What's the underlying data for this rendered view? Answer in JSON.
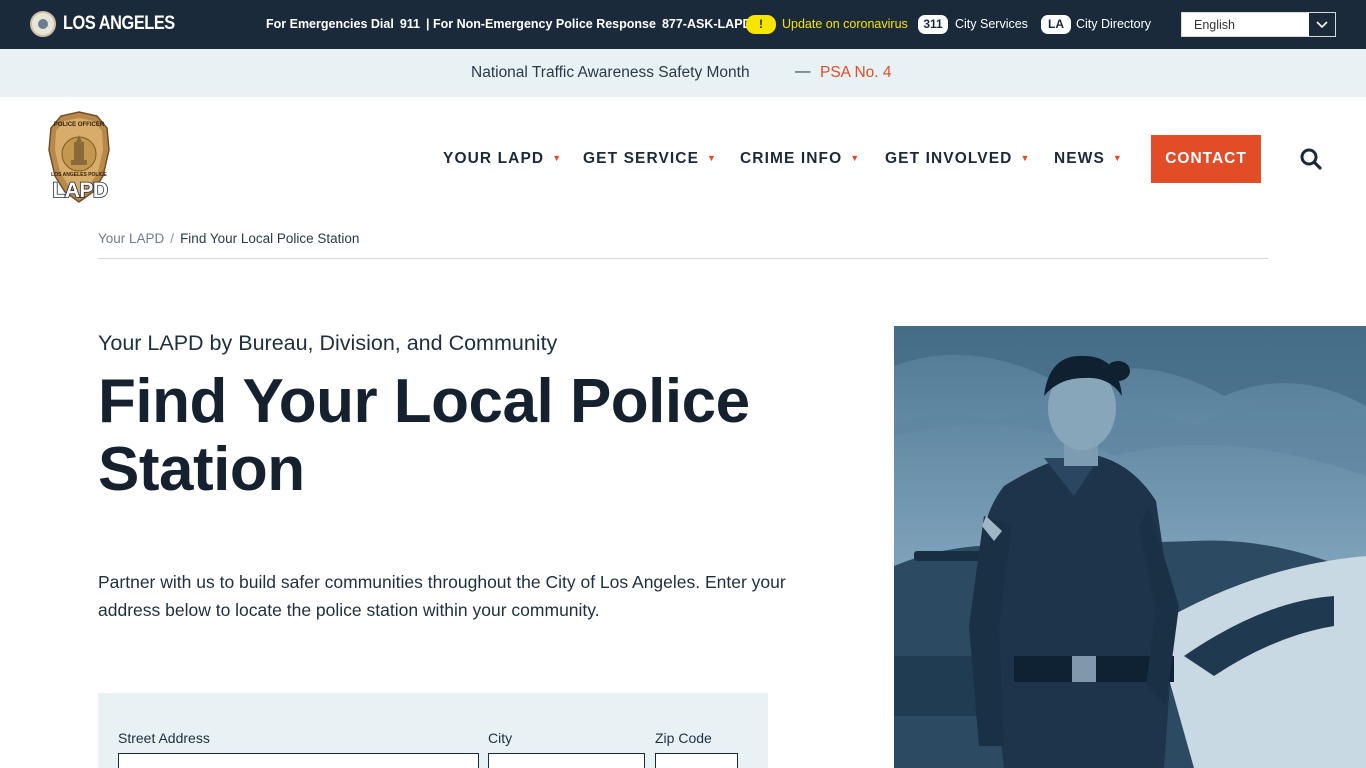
{
  "topbar": {
    "city_name": "LOS ANGELES",
    "emergency_label": "For Emergencies Dial",
    "emergency_number": "911",
    "nonemergency_label": "| For Non-Emergency Police Response",
    "nonemergency_number": "877-ASK-LAPD",
    "covid_badge": "!",
    "covid_link": "Update on coronavirus",
    "services_badge": "311",
    "services_link": "City Services",
    "directory_badge": "LA",
    "directory_link": "City Directory",
    "language_selected": "English"
  },
  "alert": {
    "text": "National Traffic Awareness Safety Month",
    "dash": "—",
    "link": "PSA No. 4"
  },
  "header": {
    "logo_text_top": "POLICE OFFICER",
    "logo_text_bottom": "LOS ANGELES POLICE",
    "logo_wordmark": "LAPD",
    "nav": [
      {
        "label": "YOUR LAPD"
      },
      {
        "label": "GET SERVICE"
      },
      {
        "label": "CRIME INFO"
      },
      {
        "label": "GET INVOLVED"
      },
      {
        "label": "NEWS"
      }
    ],
    "contact_label": "CONTACT"
  },
  "breadcrumb": {
    "parent": "Your LAPD",
    "separator": "/",
    "current": "Find Your Local Police Station"
  },
  "hero": {
    "kicker": "Your LAPD by Bureau, Division, and Community",
    "title": "Find Your Local Police Station",
    "intro": "Partner with us to build safer communities throughout the City of Los Angeles. Enter your address below to locate the police station within your community."
  },
  "form": {
    "street_label": "Street Address",
    "street_value": "",
    "city_label": "City",
    "city_value": "",
    "zip_label": "Zip Code",
    "zip_value": ""
  },
  "colors": {
    "navy": "#1b2a3a",
    "accent": "#e24d28",
    "alert_bg": "#e8f1f4",
    "covid_yellow": "#f7e500",
    "photo_tint": "#5f8aa6"
  },
  "icons": {
    "seal": "city-seal-icon",
    "search": "search-icon",
    "chevron": "chevron-down-icon"
  }
}
